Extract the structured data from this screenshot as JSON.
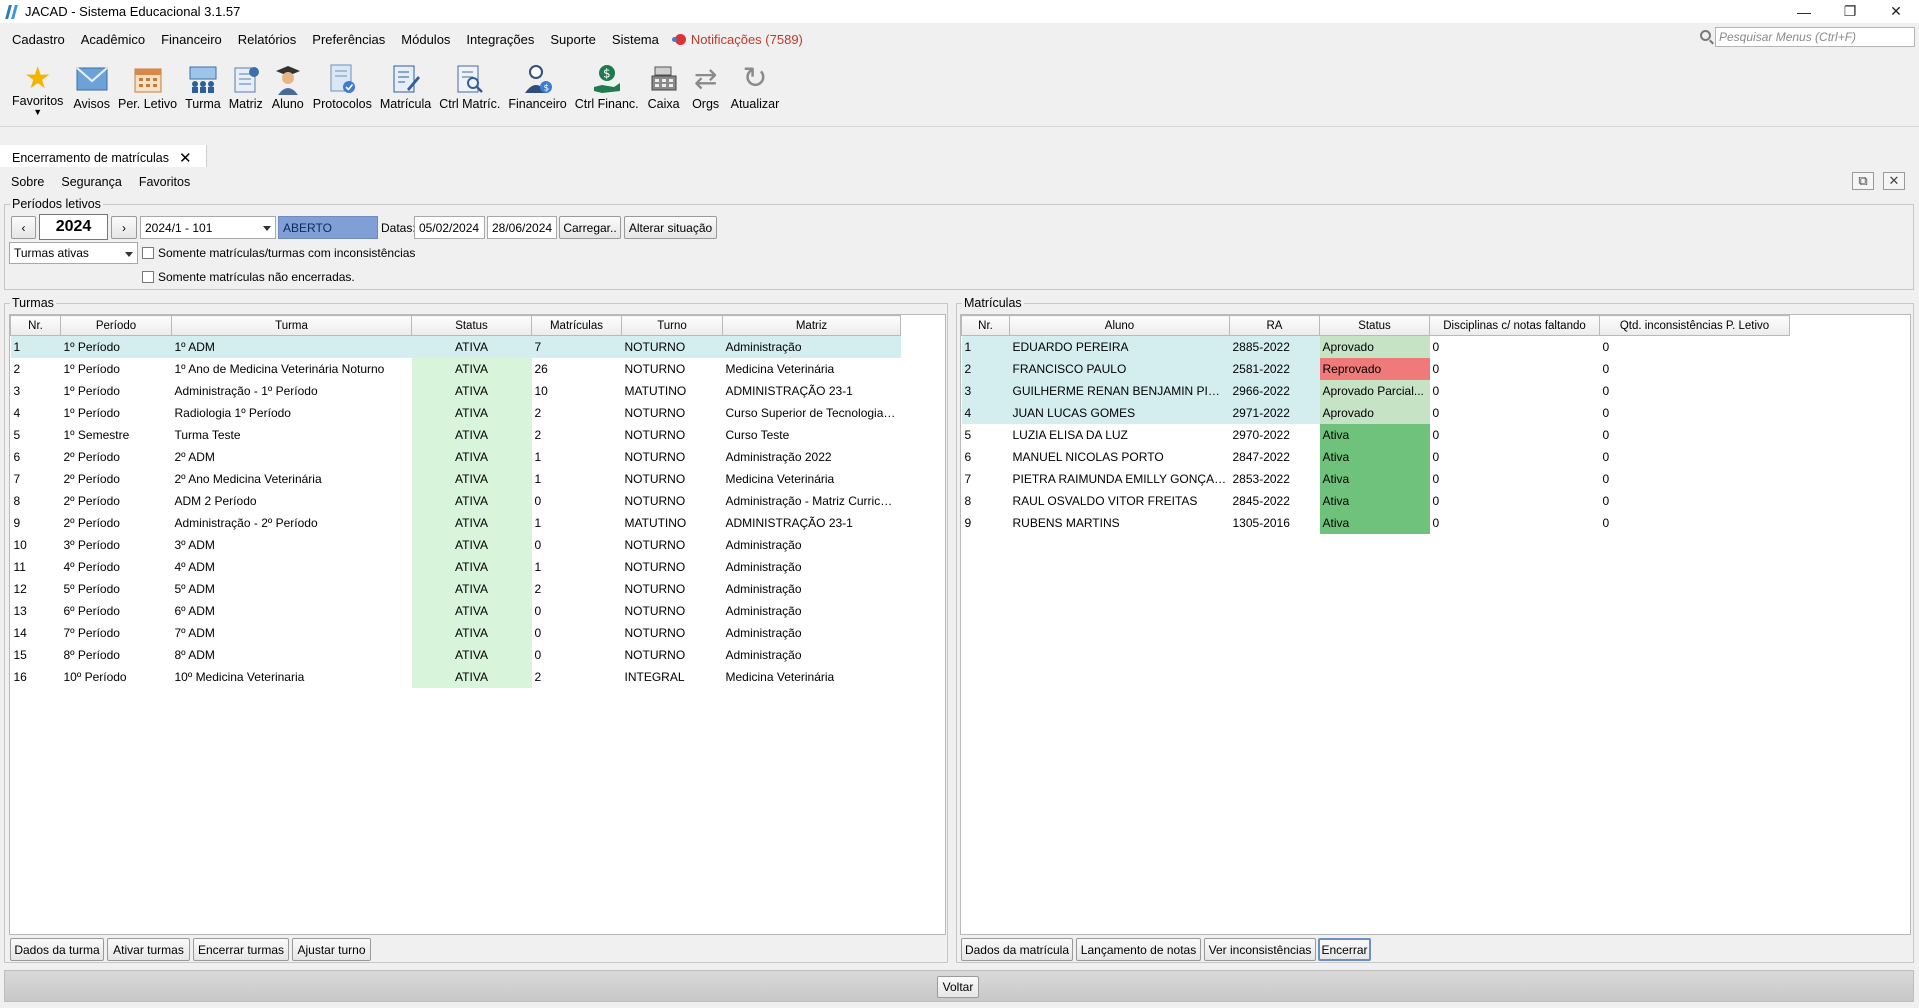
{
  "window": {
    "title": "JACAD - Sistema Educacional 3.1.57",
    "controls": [
      "—",
      "❐",
      "✕"
    ]
  },
  "menu": {
    "items": [
      "Cadastro",
      "Acadêmico",
      "Financeiro",
      "Relatórios",
      "Preferências",
      "Módulos",
      "Integrações",
      "Suporte",
      "Sistema"
    ],
    "notifications": "Notificações (7589)",
    "search_placeholder": "Pesquisar Menus (Ctrl+F)"
  },
  "toolbar": {
    "items": [
      {
        "label": "Favoritos",
        "icon": "star-icon"
      },
      {
        "label": "Avisos",
        "icon": "envelope-icon"
      },
      {
        "label": "Per. Letivo",
        "icon": "calendar-icon"
      },
      {
        "label": "Turma",
        "icon": "group-icon"
      },
      {
        "label": "Matriz",
        "icon": "matrix-icon"
      },
      {
        "label": "Aluno",
        "icon": "graduate-icon"
      },
      {
        "label": "Protocolos",
        "icon": "protocol-icon"
      },
      {
        "label": "Matrícula",
        "icon": "edit-document-icon"
      },
      {
        "label": "Ctrl Matríc.",
        "icon": "search-document-icon"
      },
      {
        "label": "Financeiro",
        "icon": "finance-person-icon"
      },
      {
        "label": "Ctrl Financ.",
        "icon": "money-hand-icon"
      },
      {
        "label": "Caixa",
        "icon": "cash-register-icon"
      },
      {
        "label": "Orgs",
        "icon": "swap-arrows-icon"
      },
      {
        "label": "Atualizar",
        "icon": "refresh-icon"
      }
    ]
  },
  "tab": {
    "label": "Encerramento de matrículas",
    "close": "✕"
  },
  "subnav": [
    "Sobre",
    "Segurança",
    "Favoritos"
  ],
  "periodos": {
    "legend": "Períodos letivos",
    "year": "2024",
    "prev": "‹",
    "next": "›",
    "periodo": "2024/1 - 101",
    "situacao": "ABERTO",
    "datas_label": "Datas:",
    "data_inicio": "05/02/2024",
    "data_fim": "28/06/2024",
    "carregar": "Carregar..",
    "alterar": "Alterar situação",
    "filtro": "Turmas ativas",
    "chk1": "Somente matrículas/turmas com inconsistências",
    "chk2": "Somente matrículas não encerradas."
  },
  "turmas": {
    "legend": "Turmas",
    "columns": [
      "Nr.",
      "Período",
      "Turma",
      "Status",
      "Matrículas",
      "Turno",
      "Matriz"
    ],
    "rows": [
      [
        "1",
        "1º Período",
        "1º ADM",
        "ATIVA",
        "7",
        "NOTURNO",
        "Administração"
      ],
      [
        "2",
        "1º Período",
        "1º Ano de Medicina Veterinária Noturno",
        "ATIVA",
        "26",
        "NOTURNO",
        "Medicina Veterinária"
      ],
      [
        "3",
        "1º Período",
        "Administração - 1º Período",
        "ATIVA",
        "10",
        "MATUTINO",
        "ADMINISTRAÇÃO 23-1"
      ],
      [
        "4",
        "1º Período",
        "Radiologia 1º Período",
        "ATIVA",
        "2",
        "NOTURNO",
        "Curso Superior de Tecnologia e..."
      ],
      [
        "5",
        "1º Semestre",
        "Turma Teste",
        "ATIVA",
        "2",
        "NOTURNO",
        "Curso Teste"
      ],
      [
        "6",
        "2º Período",
        "2º ADM",
        "ATIVA",
        "1",
        "NOTURNO",
        "Administração 2022"
      ],
      [
        "7",
        "2º Período",
        "2º Ano Medicina Veterinária",
        "ATIVA",
        "1",
        "NOTURNO",
        "Medicina Veterinária"
      ],
      [
        "8",
        "2º Período",
        "ADM 2 Período",
        "ATIVA",
        "0",
        "NOTURNO",
        "Administração - Matriz Curricul..."
      ],
      [
        "9",
        "2º Período",
        "Administração - 2º Período",
        "ATIVA",
        "1",
        "MATUTINO",
        "ADMINISTRAÇÃO 23-1"
      ],
      [
        "10",
        "3º Período",
        "3º ADM",
        "ATIVA",
        "0",
        "NOTURNO",
        "Administração"
      ],
      [
        "11",
        "4º Período",
        "4º ADM",
        "ATIVA",
        "1",
        "NOTURNO",
        "Administração"
      ],
      [
        "12",
        "5º Período",
        "5º ADM",
        "ATIVA",
        "2",
        "NOTURNO",
        "Administração"
      ],
      [
        "13",
        "6º Período",
        "6º ADM",
        "ATIVA",
        "0",
        "NOTURNO",
        "Administração"
      ],
      [
        "14",
        "7º Período",
        "7º ADM",
        "ATIVA",
        "0",
        "NOTURNO",
        "Administração"
      ],
      [
        "15",
        "8º Período",
        "8º ADM",
        "ATIVA",
        "0",
        "NOTURNO",
        "Administração"
      ],
      [
        "16",
        "10º Período",
        "10º  Medicina Veterinaria",
        "ATIVA",
        "2",
        "INTEGRAL",
        "Medicina Veterinária"
      ]
    ],
    "buttons": [
      "Dados da turma",
      "Ativar turmas",
      "Encerrar turmas",
      "Ajustar turno"
    ]
  },
  "matriculas": {
    "legend": "Matrículas",
    "columns": [
      "Nr.",
      "Aluno",
      "RA",
      "Status",
      "Disciplinas c/ notas faltando",
      "Qtd. inconsistências P. Letivo"
    ],
    "rows": [
      [
        "1",
        "EDUARDO PEREIRA",
        "2885-2022",
        "Aprovado",
        "0",
        "0"
      ],
      [
        "2",
        "FRANCISCO PAULO",
        "2581-2022",
        "Reprovado",
        "0",
        "0"
      ],
      [
        "3",
        "GUILHERME RENAN BENJAMIN PIRES",
        "2966-2022",
        "Aprovado Parcial...",
        "0",
        "0"
      ],
      [
        "4",
        "JUAN LUCAS GOMES",
        "2971-2022",
        "Aprovado",
        "0",
        "0"
      ],
      [
        "5",
        "LUZIA ELISA DA LUZ",
        "2970-2022",
        "Ativa",
        "0",
        "0"
      ],
      [
        "6",
        "MANUEL NICOLAS PORTO",
        "2847-2022",
        "Ativa",
        "0",
        "0"
      ],
      [
        "7",
        "PIETRA RAIMUNDA EMILLY GONÇALVES",
        "2853-2022",
        "Ativa",
        "0",
        "0"
      ],
      [
        "8",
        "RAUL OSVALDO VITOR FREITAS",
        "2845-2022",
        "Ativa",
        "0",
        "0"
      ],
      [
        "9",
        "RUBENS MARTINS",
        "1305-2016",
        "Ativa",
        "0",
        "0"
      ]
    ],
    "status_classes": [
      "st-aprovado",
      "st-reprovado",
      "st-parcial",
      "st-aprovado",
      "st-ativa2",
      "st-ativa2",
      "st-ativa2",
      "st-ativa2",
      "st-ativa2"
    ],
    "highlighted_rows": [
      0,
      1,
      2,
      3
    ],
    "buttons": [
      "Dados da matrícula",
      "Lançamento de notas",
      "Ver inconsistências",
      "Encerrar"
    ]
  },
  "footer": {
    "back": "Voltar"
  },
  "colors": {
    "selection": "#d4eef0",
    "ativa_light": "#d8f5dc",
    "ativa_strong": "#6ec27b",
    "reprovado": "#f07a7a",
    "aberto": "#7f9fd6"
  }
}
